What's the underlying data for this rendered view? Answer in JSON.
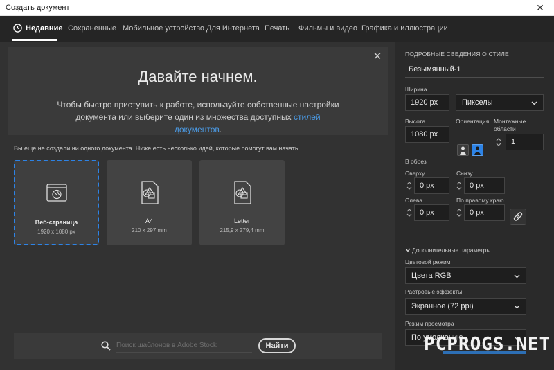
{
  "window": {
    "title": "Создать документ",
    "close_glyph": "✕"
  },
  "tabs": [
    {
      "label": "Недавние",
      "icon": "clock-icon",
      "active": true
    },
    {
      "label": "Сохраненные"
    },
    {
      "label": "Мобильное устройство"
    },
    {
      "label": "Для Интернета"
    },
    {
      "label": "Печать"
    },
    {
      "label": "Фильмы и видео"
    },
    {
      "label": "Графика и иллюстрации"
    }
  ],
  "hero": {
    "title": "Давайте начнем.",
    "desc_part1": "Чтобы быстро приступить к работе, используйте собственные настройки документа или выберите один из множества доступных ",
    "desc_link": "стилей документов",
    "desc_part2": ".",
    "close_glyph": "✕"
  },
  "hint": "Вы еще не создали ни одного документа. Ниже есть несколько идей, которые помогут вам начать.",
  "cards": [
    {
      "name": "Веб-страница",
      "size": "1920 x 1080 px",
      "icon": "web-page-icon",
      "selected": true
    },
    {
      "name": "A4",
      "size": "210 x 297 mm",
      "icon": "document-shapes-icon"
    },
    {
      "name": "Letter",
      "size": "215,9 x 279,4 mm",
      "icon": "document-shapes-icon"
    }
  ],
  "search": {
    "placeholder": "Поиск шаблонов в Adobe Stock",
    "button": "Найти"
  },
  "details": {
    "section_title": "ПОДРОБНЫЕ СВЕДЕНИЯ О СТИЛЕ",
    "doc_name": "Безымянный-1",
    "width_label": "Ширина",
    "width_value": "1920 px",
    "units_value": "Пикселы",
    "height_label": "Высота",
    "height_value": "1080 px",
    "orientation_label": "Ориентация",
    "artboards_label_1": "Монтажные",
    "artboards_label_2": "области",
    "artboards_value": "1",
    "bleed_label": "В обрез",
    "top_label": "Сверху",
    "top_value": "0 px",
    "bottom_label": "Снизу",
    "bottom_value": "0 px",
    "left_label": "Слева",
    "left_value": "0 px",
    "right_label": "По правому краю",
    "right_value": "0 px",
    "advanced_label": "Дополнительные параметры",
    "color_mode_label": "Цветовой режим",
    "color_mode_value": "Цвета RGB",
    "raster_label": "Растровые эффекты",
    "raster_value": "Экранное (72 ppi)",
    "preview_label": "Режим просмотра",
    "preview_value": "По умолчанию"
  },
  "watermark": "PCPROGS.NET",
  "colors": {
    "accent": "#2d83e6",
    "link": "#4b9ce8",
    "bg": "#323232",
    "panel": "#2a2a2a"
  }
}
